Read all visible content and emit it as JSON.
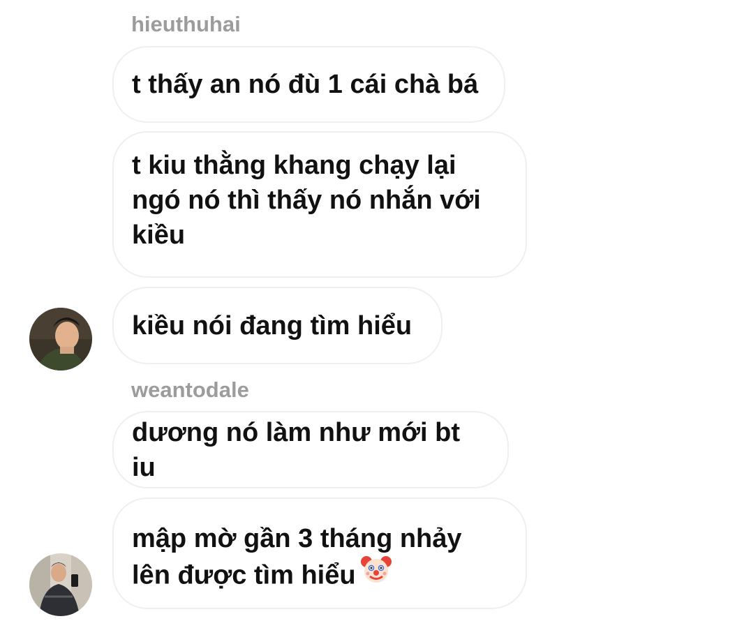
{
  "groups": [
    {
      "sender": "hieuthuhai",
      "messages": [
        "t thấy an nó đù 1 cái chà bá",
        "t kiu thằng khang chạy lại ngó nó thì thấy nó nhắn với kiều",
        "kiều nói đang tìm hiểu"
      ],
      "avatar_icon": "user-avatar-photo"
    },
    {
      "sender": "weantodale",
      "messages": [
        "dương nó làm như mới bt iu",
        "mập mờ gần 3 tháng nhảy lên được tìm hiểu"
      ],
      "last_message_emoji": "clown-face-emoji",
      "avatar_icon": "user-avatar-photo"
    }
  ],
  "colors": {
    "bubble_border": "#efefef",
    "sender_name": "#9c9c9c",
    "message_text": "#111111",
    "background": "#ffffff"
  }
}
